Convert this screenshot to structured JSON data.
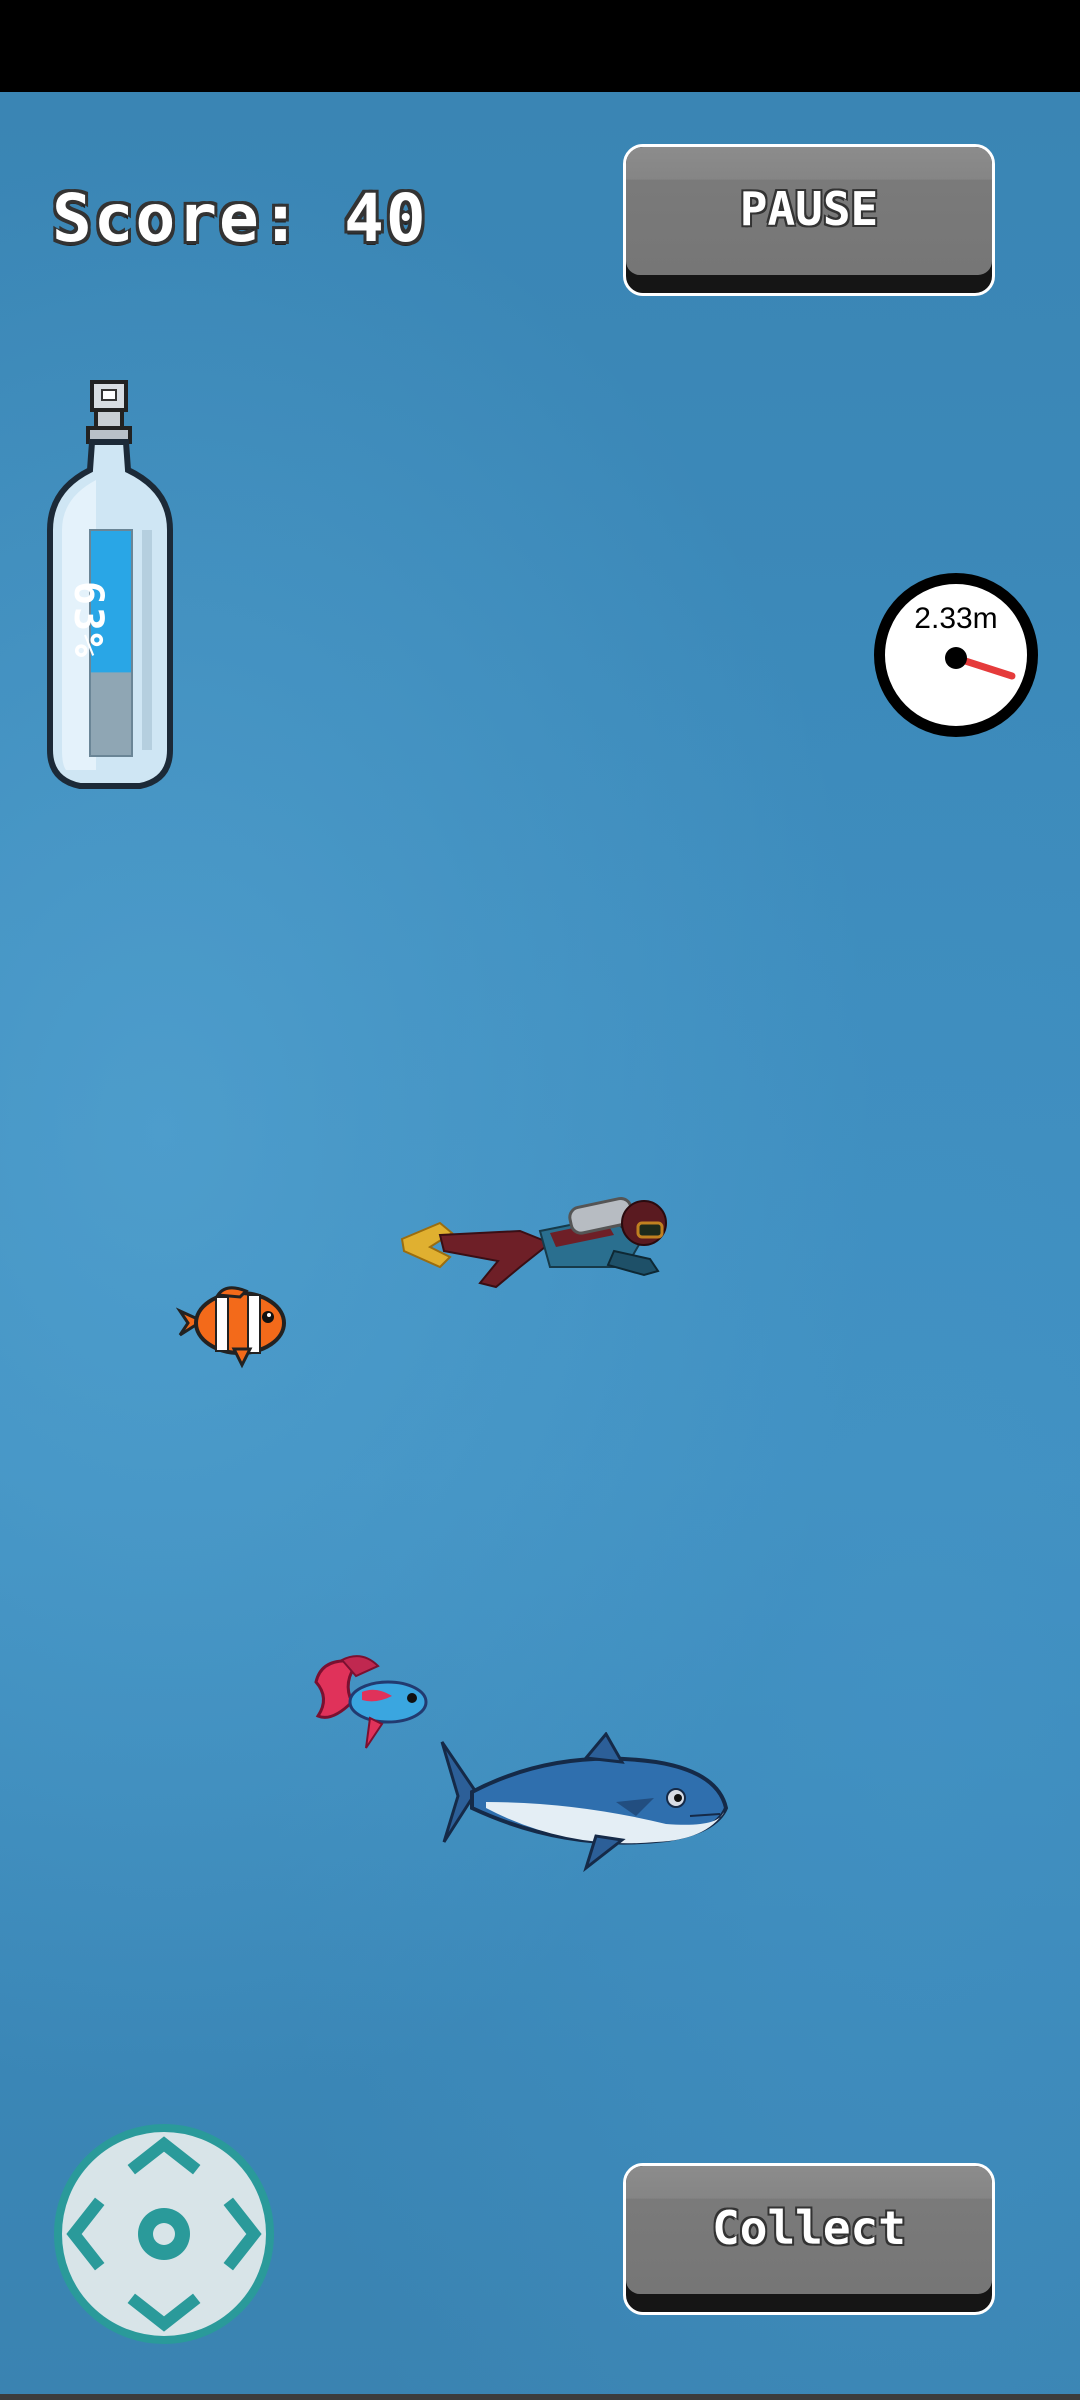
{
  "hud": {
    "score_text": "Score: 40",
    "pause_label": "PAUSE",
    "collect_label": "Collect"
  },
  "oxygen": {
    "label": "63%",
    "level": 0.63
  },
  "depth": {
    "label": "2.33m"
  },
  "colors": {
    "water": "#3d8cbd",
    "button_face": "#7a7a7a",
    "gauge_needle": "#e53b3b",
    "oxygen_fill": "#29a6e6",
    "dpad": "#2a9a9a"
  },
  "icons": {
    "dpad": "dpad-icon",
    "oxygen_tank": "oxygen-tank-icon",
    "depth_gauge": "depth-gauge-icon"
  },
  "creatures": [
    "diver",
    "clownfish",
    "betta-fish",
    "tuna"
  ]
}
